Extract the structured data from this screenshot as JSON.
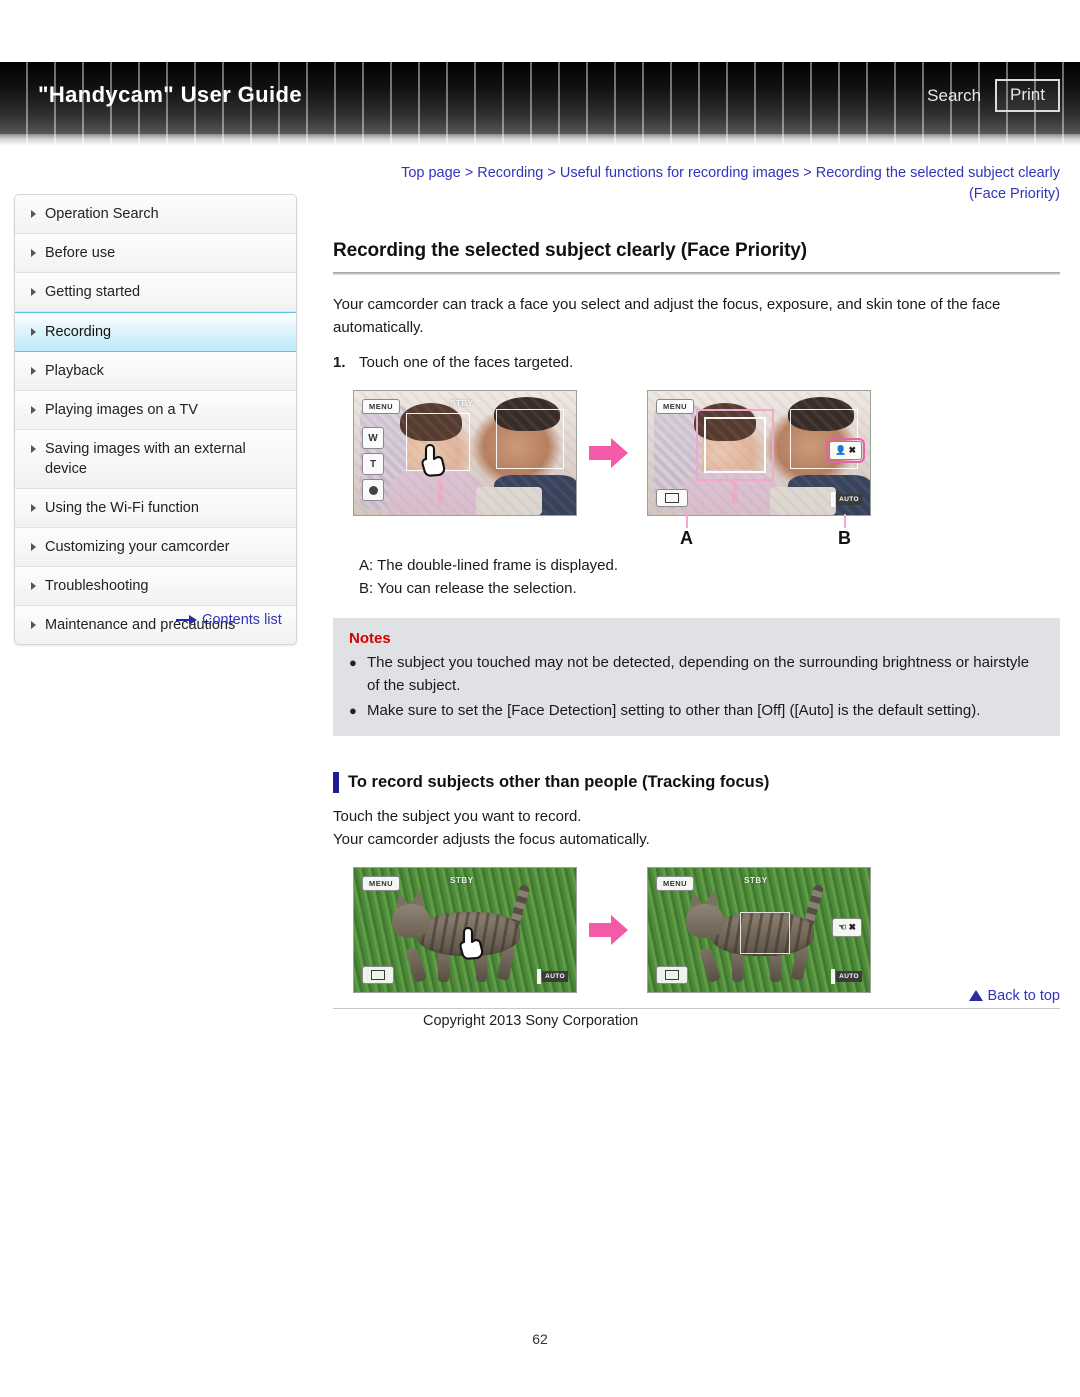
{
  "header": {
    "title": "\"Handycam\" User Guide",
    "search_label": "Search",
    "print_label": "Print"
  },
  "breadcrumb": {
    "items": [
      "Top page",
      "Recording",
      "Useful functions for recording images",
      "Recording the selected subject clearly (Face Priority)"
    ],
    "separator": ">",
    "line1": "Top page > Recording > Useful functions for recording images > Recording the selected subject clearly",
    "line2": "(Face Priority)"
  },
  "sidebar": {
    "items": [
      {
        "label": "Operation Search",
        "active": false
      },
      {
        "label": "Before use",
        "active": false
      },
      {
        "label": "Getting started",
        "active": false
      },
      {
        "label": "Recording",
        "active": true
      },
      {
        "label": "Playback",
        "active": false
      },
      {
        "label": "Playing images on a TV",
        "active": false
      },
      {
        "label": "Saving images with an external device",
        "active": false
      },
      {
        "label": "Using the Wi-Fi function",
        "active": false
      },
      {
        "label": "Customizing your camcorder",
        "active": false
      },
      {
        "label": "Troubleshooting",
        "active": false
      },
      {
        "label": "Maintenance and precautions",
        "active": false
      }
    ],
    "contents_list_label": "Contents list"
  },
  "main": {
    "page_title": "Recording the selected subject clearly (Face Priority)",
    "intro": "Your camcorder can track a face you select and adjust the focus, exposure, and skin tone of the face automatically.",
    "step1_num": "1.",
    "step1_text": "Touch one of the faces targeted.",
    "callout_a": "A",
    "callout_b": "B",
    "ab_a_text": "A: The double-lined frame is displayed.",
    "ab_b_text": "B: You can release the selection.",
    "notes": {
      "title": "Notes",
      "bullet": "●",
      "items": [
        "The subject you touched may not be detected, depending on the surrounding brightness or hairstyle of the subject.",
        "Make sure to set the [Face Detection] setting to other than [Off] ([Auto] is the default setting)."
      ]
    },
    "subheading": "To record subjects other than people (Tracking focus)",
    "sub_line1": "Touch the subject you want to record.",
    "sub_line2": "Your camcorder adjusts the focus automatically."
  },
  "camera_osd": {
    "menu_label": "MENU",
    "standby_label": "STBY",
    "zoom_w": "W",
    "zoom_t": "T",
    "auto_label": "AUTO",
    "release_label": "✖"
  },
  "footer": {
    "back_to_top": "Back to top",
    "copyright": "Copyright 2013 Sony Corporation",
    "page_number": "62"
  },
  "colors": {
    "link": "#3333bb",
    "notes_title": "#d50000",
    "notes_bg": "#dfe1e5",
    "accent_pink": "#f35ba8",
    "subhead_bar": "#1c1c96",
    "sidebar_active": "#bde9f8"
  }
}
